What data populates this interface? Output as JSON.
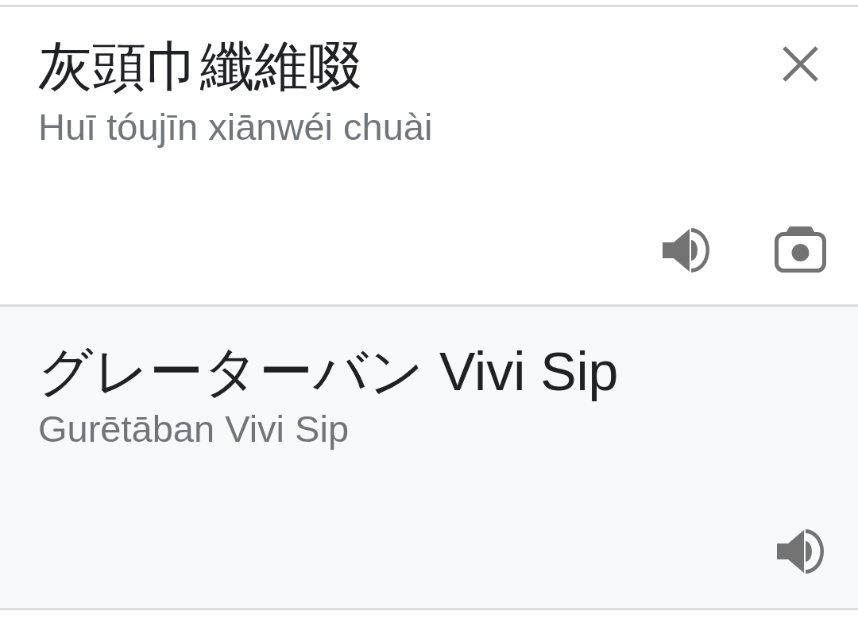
{
  "source": {
    "text": "灰頭巾纖維啜",
    "romanization": "Huī tóujīn xiānwéi chuài"
  },
  "translation": {
    "text": "グレーターバン Vivi Sip",
    "romanization": "Gurētāban Vivi Sip"
  }
}
